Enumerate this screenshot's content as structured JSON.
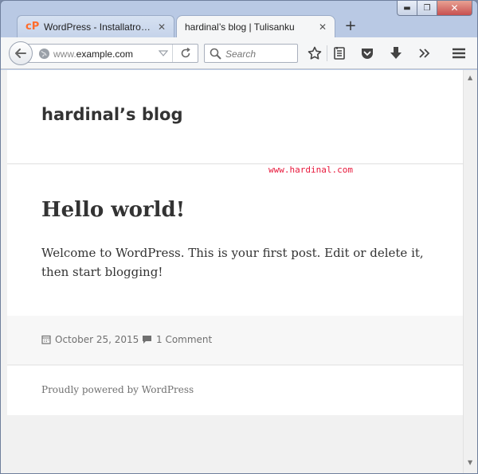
{
  "window": {
    "controls": {
      "minimize": "▬",
      "maximize": "❐",
      "close": "✕"
    }
  },
  "tabs": [
    {
      "title": "WordPress - Installatron ...",
      "icon": "cpanel-icon",
      "active": false
    },
    {
      "title": "hardinal’s blog | Tulisanku",
      "active": true
    }
  ],
  "tab_close": "✕",
  "new_tab": "+",
  "toolbar": {
    "url_prefix": "www.",
    "url_domain": "example.com",
    "search_placeholder": "Search"
  },
  "site": {
    "title": "hardinal’s blog",
    "watermark": "www.hardinal.com"
  },
  "post": {
    "title": "Hello world!",
    "body": "Welcome to WordPress. This is your first post. Edit or delete it, then start blogging!",
    "date": "October 25, 2015",
    "comments": "1 Comment"
  },
  "footer": {
    "powered": "Proudly powered by WordPress"
  },
  "colors": {
    "accent_cpanel": "#ff6c2c",
    "watermark": "#e8193c"
  }
}
